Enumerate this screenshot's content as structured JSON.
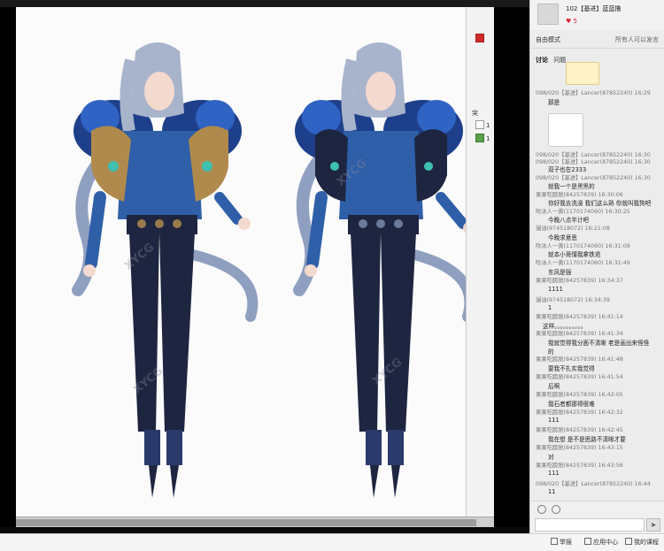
{
  "chat": {
    "header": {
      "title": "102【基进】蓝蓝撸",
      "likes": "♥ 5"
    },
    "mode_left": "自由模式",
    "mode_right": "所有人可以发言",
    "tabs": [
      "讨论",
      "问题"
    ],
    "messages": [
      {
        "meta": "098/020【基进】Lancer(87852240) 16:29",
        "text": "那是"
      },
      {
        "meta": "098/020【基进】Lancer(87852240) 16:30",
        "text": ""
      },
      {
        "meta": "098/020【基进】Lancer(87852240) 16:30",
        "text": "双子也在2333"
      },
      {
        "meta": "098/020【基进】Lancer(87852240) 16:30",
        "text": "就我一个是黑黑的"
      },
      {
        "meta": "果果吃膀胱(84257839) 16:30:06",
        "text": "你好我去洗澡 我们这么熟 你就叫我狗吧"
      },
      {
        "meta": "吹冰人一黄(1170174060) 16:30:25",
        "text": "今晚八点半计吧"
      },
      {
        "meta": "馒油(974518072) 16:21:08",
        "text": "今晚求意思"
      },
      {
        "meta": "吹冰人一黄(1170174060) 16:31:09",
        "text": "就本小哥懂我拿铁退"
      },
      {
        "meta": "吹冰人一黄(1170174060) 16:31:49",
        "text": "东风是强"
      },
      {
        "meta": "果果吃膀胱(84257839) 16:34:37",
        "text": "1111"
      },
      {
        "meta": "馒油(974518072) 16:34:39",
        "text": "1"
      },
      {
        "meta": "果果吃膀胱(84257839) 16:41:14",
        "text": "这样。。。。。。。。。。"
      },
      {
        "meta": "果果吃膀胱(84257839) 16:41:34",
        "text": "我就觉得我分面不清晰 老是画出来怪怪的"
      },
      {
        "meta": "果果吃膀胱(84257839) 16:41:48",
        "text": "要我不扎实我觉得"
      },
      {
        "meta": "果果吃膀胱(84257839) 16:41:54",
        "text": "后啊"
      },
      {
        "meta": "果果吃膀胱(84257839) 16:42:05",
        "text": "我石者都那得很难"
      },
      {
        "meta": "果果吃膀胱(84257839) 16:42:32",
        "text": "111"
      },
      {
        "meta": "果果吃膀胱(84257839) 16:42:45",
        "text": "我在想 是不是思路不清晰才要"
      },
      {
        "meta": "果果吃膀胱(84257839) 16:43:15",
        "text": "对"
      },
      {
        "meta": "果果吃膀胱(84257839) 16:43:56",
        "text": "111"
      },
      {
        "meta": "098/020【基进】Lancer(87852240) 16:44",
        "text": "11"
      }
    ],
    "send_label": "➤"
  },
  "right_panel": {
    "items": [
      "突",
      "1",
      "1"
    ]
  },
  "watermark": "XYCG",
  "bottom_bar": {
    "report": "举报",
    "app_center": "应用中心",
    "my_courses": "我的课程"
  },
  "colors": {
    "accent_red": "#d22233",
    "hair": "#a8b3cc",
    "shirt": "#2f5fa8",
    "pants": "#1d2540",
    "feather": "#1e3f8a",
    "gold": "#b08a4c"
  }
}
